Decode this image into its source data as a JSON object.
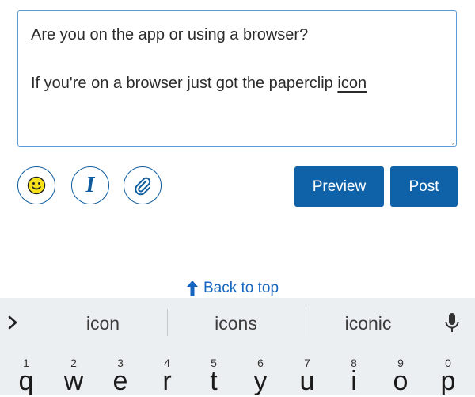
{
  "composer": {
    "line1": "Are you on the app or using a browser?",
    "line2_prefix": "If you're on a browser just got the paperclip ",
    "line2_underlined": "icon"
  },
  "toolbar": {
    "emoji_icon": "smiley-icon",
    "italic_label": "I",
    "attach_icon": "paperclip-icon",
    "preview_label": "Preview",
    "post_label": "Post"
  },
  "back_to_top": {
    "label": "Back to top",
    "icon": "arrow-up-icon"
  },
  "keyboard": {
    "suggestions": [
      "icon",
      "icons",
      "iconic"
    ],
    "expand_icon": "chevron-right-icon",
    "mic_icon": "microphone-icon",
    "keys": [
      {
        "hint": "1",
        "letter": "q"
      },
      {
        "hint": "2",
        "letter": "w"
      },
      {
        "hint": "3",
        "letter": "e"
      },
      {
        "hint": "4",
        "letter": "r"
      },
      {
        "hint": "5",
        "letter": "t"
      },
      {
        "hint": "6",
        "letter": "y"
      },
      {
        "hint": "7",
        "letter": "u"
      },
      {
        "hint": "8",
        "letter": "i"
      },
      {
        "hint": "9",
        "letter": "o"
      },
      {
        "hint": "0",
        "letter": "p"
      }
    ]
  },
  "colors": {
    "primary": "#0f62a8",
    "link": "#1565c0",
    "border": "#5b9bd5",
    "keyboard_bg": "#eceff1"
  }
}
